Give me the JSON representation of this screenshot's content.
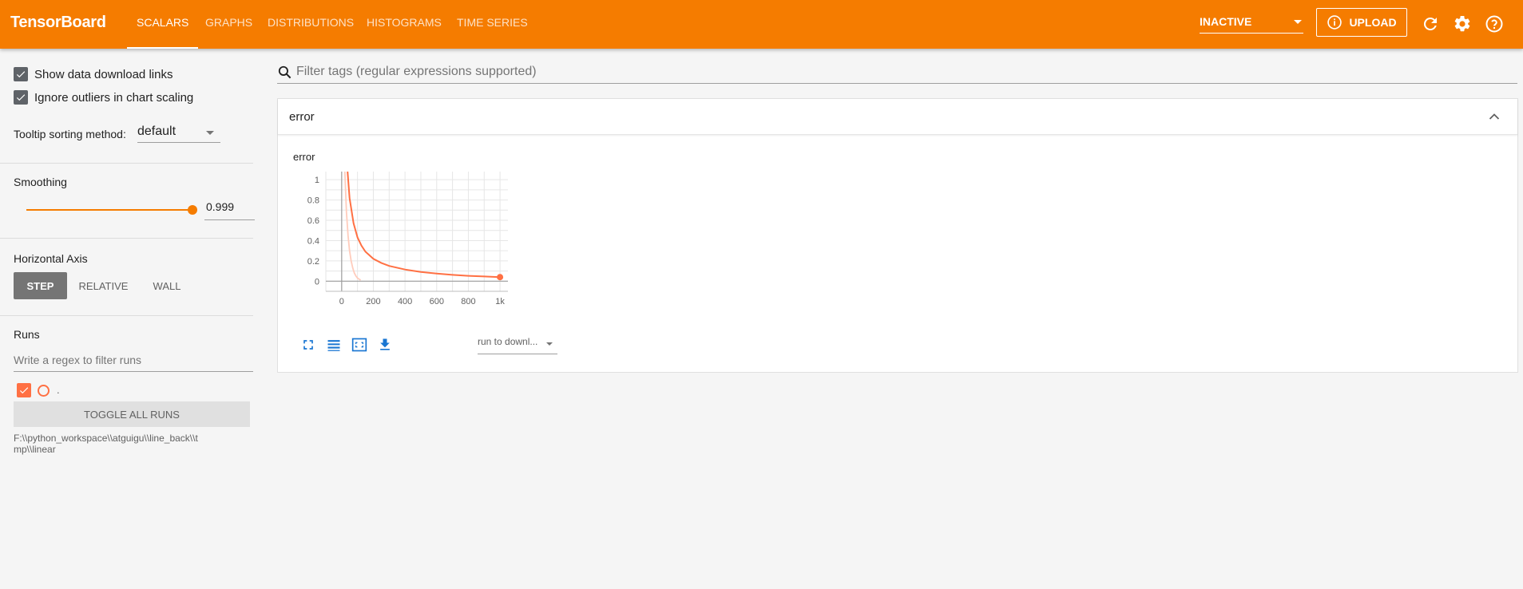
{
  "header": {
    "app_title": "TensorBoard",
    "tabs": [
      "SCALARS",
      "GRAPHS",
      "DISTRIBUTIONS",
      "HISTOGRAMS",
      "TIME SERIES"
    ],
    "active_tab": "SCALARS",
    "status_select": "INACTIVE",
    "upload_label": "UPLOAD",
    "icons": [
      "refresh-icon",
      "settings-icon",
      "help-icon"
    ],
    "accent_color": "#f57c00"
  },
  "sidebar": {
    "show_download_links": {
      "label": "Show data download links",
      "checked": true
    },
    "ignore_outliers": {
      "label": "Ignore outliers in chart scaling",
      "checked": true
    },
    "tooltip_sorting": {
      "label": "Tooltip sorting method:",
      "value": "default"
    },
    "smoothing": {
      "label": "Smoothing",
      "value": "0.999",
      "level": 0.999
    },
    "horizontal_axis": {
      "label": "Horizontal Axis",
      "options": [
        "STEP",
        "RELATIVE",
        "WALL"
      ],
      "selected": "STEP"
    },
    "runs": {
      "label": "Runs",
      "filter_placeholder": "Write a regex to filter runs",
      "run_name": ".",
      "run_color": "#ff7043",
      "toggle_all_label": "TOGGLE ALL RUNS",
      "log_dir": "F:\\\\python_workspace\\\\atguigu\\\\line_back\\\\tmp\\\\linear"
    }
  },
  "main": {
    "filter_placeholder": "Filter tags (regular expressions supported)",
    "card_title": "error",
    "run_select_label": "run to downl..."
  },
  "chart_data": {
    "type": "line",
    "title": "error",
    "xlim": [
      -100,
      1050
    ],
    "ylim": [
      -0.1,
      1.08
    ],
    "x_ticks": [
      0,
      200,
      400,
      600,
      800,
      1000
    ],
    "x_tick_labels": [
      "0",
      "200",
      "400",
      "600",
      "800",
      "1k"
    ],
    "y_ticks": [
      0,
      0.2,
      0.4,
      0.6,
      0.8,
      1
    ],
    "y_tick_labels": [
      "0",
      "0.2",
      "0.4",
      "0.6",
      "0.8",
      "1"
    ],
    "grid": true,
    "series": [
      {
        "role": "raw",
        "color": "#ffccbc",
        "x": [
          20,
          30,
          40,
          50,
          60,
          70,
          80,
          90,
          100,
          120
        ],
        "y": [
          1.08,
          0.68,
          0.45,
          0.3,
          0.2,
          0.13,
          0.08,
          0.05,
          0.03,
          0.01
        ]
      },
      {
        "role": "smoothed",
        "color": "#ff7043",
        "x": [
          37,
          50,
          75,
          100,
          125,
          150,
          200,
          250,
          300,
          400,
          500,
          600,
          700,
          800,
          900,
          1000
        ],
        "y": [
          1.08,
          0.82,
          0.57,
          0.43,
          0.35,
          0.29,
          0.22,
          0.18,
          0.15,
          0.115,
          0.09,
          0.075,
          0.062,
          0.053,
          0.046,
          0.04
        ]
      }
    ]
  }
}
